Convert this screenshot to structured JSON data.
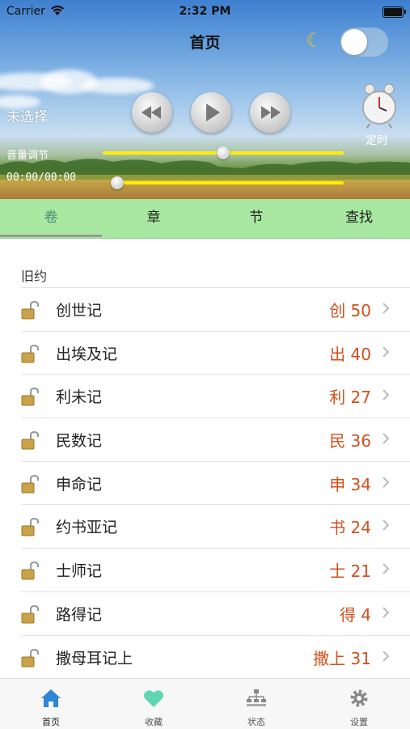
{
  "status_bar": {
    "carrier": "Carrier",
    "time": "2:32 PM"
  },
  "header": {
    "title": "首页"
  },
  "player": {
    "selection": "未选择",
    "volume_label": "音量调节",
    "time_readout": "00:00/00:00",
    "timer_label": "定时",
    "volume_level": 0.5,
    "progress_level": 0.0
  },
  "colors": {
    "tab_background": "#a8e8a0",
    "accent_red": "#d2501e",
    "progress_yellow": "#ffee00"
  },
  "segment_tabs": [
    {
      "label": "卷",
      "active": true
    },
    {
      "label": "章"
    },
    {
      "label": "节"
    },
    {
      "label": "查找"
    }
  ],
  "list": {
    "section_title": "旧约",
    "items": [
      {
        "name": "创世记",
        "abbr": "创 50"
      },
      {
        "name": "出埃及记",
        "abbr": "出 40"
      },
      {
        "name": "利未记",
        "abbr": "利 27"
      },
      {
        "name": "民数记",
        "abbr": "民 36"
      },
      {
        "name": "申命记",
        "abbr": "申 34"
      },
      {
        "name": "约书亚记",
        "abbr": "书 24"
      },
      {
        "name": "士师记",
        "abbr": "士 21"
      },
      {
        "name": "路得记",
        "abbr": "得 4"
      },
      {
        "name": "撒母耳记上",
        "abbr": "撒上 31"
      }
    ]
  },
  "tab_bar": [
    {
      "label": "首页",
      "icon": "home-icon",
      "active": true
    },
    {
      "label": "收藏",
      "icon": "heart-icon"
    },
    {
      "label": "状态",
      "icon": "hierarchy-icon"
    },
    {
      "label": "设置",
      "icon": "gear-icon"
    }
  ]
}
